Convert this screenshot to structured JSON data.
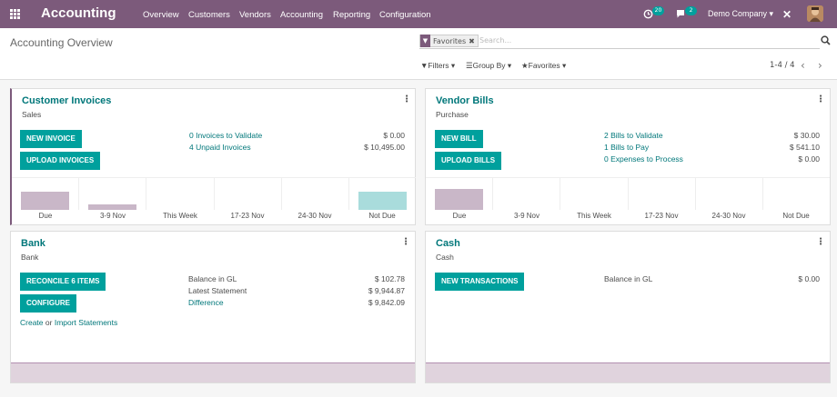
{
  "navbar": {
    "brand": "Accounting",
    "menu": [
      "Overview",
      "Customers",
      "Vendors",
      "Accounting",
      "Reporting",
      "Configuration"
    ],
    "activity_count": "20",
    "messages_count": "2",
    "company": "Demo Company ▾",
    "close_glyph": "✕"
  },
  "control": {
    "title": "Accounting Overview",
    "facet_label": "Favorites",
    "facet_remove": "✖",
    "search_placeholder": "Search...",
    "filters": "Filters ▾",
    "group_by": "Group By ▾",
    "favorites": "Favorites ▾",
    "pager": "1-4 / 4",
    "prev": "‹",
    "next": "›"
  },
  "customer_invoices": {
    "title": "Customer Invoices",
    "subtitle": "Sales",
    "btn_new": "NEW INVOICE",
    "btn_upload": "UPLOAD INVOICES",
    "rows": [
      {
        "label": "0 Invoices to Validate",
        "amount": "$ 0.00"
      },
      {
        "label": "4 Unpaid Invoices",
        "amount": "$ 10,495.00"
      }
    ]
  },
  "vendor_bills": {
    "title": "Vendor Bills",
    "subtitle": "Purchase",
    "btn_new": "NEW BILL",
    "btn_upload": "UPLOAD BILLS",
    "rows": [
      {
        "label": "2 Bills to Validate",
        "amount": "$ 30.00"
      },
      {
        "label": "1 Bills to Pay",
        "amount": "$ 541.10"
      },
      {
        "label": "0 Expenses to Process",
        "amount": "$ 0.00"
      }
    ]
  },
  "bank": {
    "title": "Bank",
    "subtitle": "Bank",
    "btn_reconcile": "RECONCILE 6 ITEMS",
    "btn_configure": "CONFIGURE",
    "link_create": "Create",
    "or_text": "or",
    "link_import": "Import Statements",
    "rows": [
      {
        "label": "Balance in GL",
        "amount": "$ 102.78"
      },
      {
        "label": "Latest Statement",
        "amount": "$ 9,944.87"
      },
      {
        "label": "Difference",
        "amount": "$ 9,842.09"
      }
    ]
  },
  "cash": {
    "title": "Cash",
    "subtitle": "Cash",
    "btn_new": "NEW TRANSACTIONS",
    "rows": [
      {
        "label": "Balance in GL",
        "amount": "$ 0.00"
      }
    ]
  },
  "graph_labels": [
    "Due",
    "3-9 Nov",
    "This Week",
    "17-23 Nov",
    "24-30 Nov",
    "Not Due"
  ],
  "customer_graph": {
    "values": [
      0.66,
      0.2,
      0,
      0,
      0,
      0.66
    ],
    "colors": [
      "#c9b7c8",
      "#c9b7c8",
      "#c9b7c8",
      "#c9b7c8",
      "#c9b7c8",
      "#a9dcdc"
    ]
  },
  "vendor_graph": {
    "values": [
      0.75,
      0,
      0,
      0,
      0,
      0
    ],
    "colors": [
      "#c9b7c8",
      "#c9b7c8",
      "#c9b7c8",
      "#c9b7c8",
      "#c9b7c8",
      "#c9b7c8"
    ]
  },
  "colors": {
    "primary": "#7c5a7b",
    "accent": "#00a09d",
    "link": "#00777a"
  }
}
